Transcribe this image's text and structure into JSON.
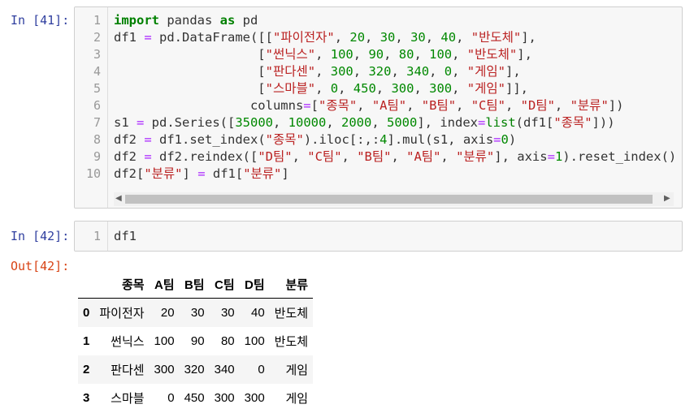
{
  "cells": [
    {
      "prompt": "In [41]:",
      "line_numbers": [
        "1",
        "2",
        "3",
        "4",
        "5",
        "6",
        "7",
        "8",
        "9",
        "10"
      ],
      "code_lines": [
        [
          {
            "t": "k",
            "v": "import"
          },
          {
            "t": "",
            "v": " pandas "
          },
          {
            "t": "k",
            "v": "as"
          },
          {
            "t": "",
            "v": " pd"
          }
        ],
        [
          {
            "t": "",
            "v": "df1 "
          },
          {
            "t": "o",
            "v": "="
          },
          {
            "t": "",
            "v": " pd.DataFrame([["
          },
          {
            "t": "s",
            "v": "\"파이전자\""
          },
          {
            "t": "",
            "v": ", "
          },
          {
            "t": "n",
            "v": "20"
          },
          {
            "t": "",
            "v": ", "
          },
          {
            "t": "n",
            "v": "30"
          },
          {
            "t": "",
            "v": ", "
          },
          {
            "t": "n",
            "v": "30"
          },
          {
            "t": "",
            "v": ", "
          },
          {
            "t": "n",
            "v": "40"
          },
          {
            "t": "",
            "v": ", "
          },
          {
            "t": "s",
            "v": "\"반도체\""
          },
          {
            "t": "",
            "v": "],"
          }
        ],
        [
          {
            "t": "",
            "v": "                   ["
          },
          {
            "t": "s",
            "v": "\"썬닉스\""
          },
          {
            "t": "",
            "v": ", "
          },
          {
            "t": "n",
            "v": "100"
          },
          {
            "t": "",
            "v": ", "
          },
          {
            "t": "n",
            "v": "90"
          },
          {
            "t": "",
            "v": ", "
          },
          {
            "t": "n",
            "v": "80"
          },
          {
            "t": "",
            "v": ", "
          },
          {
            "t": "n",
            "v": "100"
          },
          {
            "t": "",
            "v": ", "
          },
          {
            "t": "s",
            "v": "\"반도체\""
          },
          {
            "t": "",
            "v": "],"
          }
        ],
        [
          {
            "t": "",
            "v": "                   ["
          },
          {
            "t": "s",
            "v": "\"판다센\""
          },
          {
            "t": "",
            "v": ", "
          },
          {
            "t": "n",
            "v": "300"
          },
          {
            "t": "",
            "v": ", "
          },
          {
            "t": "n",
            "v": "320"
          },
          {
            "t": "",
            "v": ", "
          },
          {
            "t": "n",
            "v": "340"
          },
          {
            "t": "",
            "v": ", "
          },
          {
            "t": "n",
            "v": "0"
          },
          {
            "t": "",
            "v": ", "
          },
          {
            "t": "s",
            "v": "\"게임\""
          },
          {
            "t": "",
            "v": "],"
          }
        ],
        [
          {
            "t": "",
            "v": "                   ["
          },
          {
            "t": "s",
            "v": "\"스마블\""
          },
          {
            "t": "",
            "v": ", "
          },
          {
            "t": "n",
            "v": "0"
          },
          {
            "t": "",
            "v": ", "
          },
          {
            "t": "n",
            "v": "450"
          },
          {
            "t": "",
            "v": ", "
          },
          {
            "t": "n",
            "v": "300"
          },
          {
            "t": "",
            "v": ", "
          },
          {
            "t": "n",
            "v": "300"
          },
          {
            "t": "",
            "v": ", "
          },
          {
            "t": "s",
            "v": "\"게임\""
          },
          {
            "t": "",
            "v": "]],"
          }
        ],
        [
          {
            "t": "",
            "v": "                  columns"
          },
          {
            "t": "o",
            "v": "="
          },
          {
            "t": "",
            "v": "["
          },
          {
            "t": "s",
            "v": "\"종목\""
          },
          {
            "t": "",
            "v": ", "
          },
          {
            "t": "s",
            "v": "\"A팀\""
          },
          {
            "t": "",
            "v": ", "
          },
          {
            "t": "s",
            "v": "\"B팀\""
          },
          {
            "t": "",
            "v": ", "
          },
          {
            "t": "s",
            "v": "\"C팀\""
          },
          {
            "t": "",
            "v": ", "
          },
          {
            "t": "s",
            "v": "\"D팀\""
          },
          {
            "t": "",
            "v": ", "
          },
          {
            "t": "s",
            "v": "\"분류\""
          },
          {
            "t": "",
            "v": "])"
          }
        ],
        [
          {
            "t": "",
            "v": "s1 "
          },
          {
            "t": "o",
            "v": "="
          },
          {
            "t": "",
            "v": " pd.Series(["
          },
          {
            "t": "n",
            "v": "35000"
          },
          {
            "t": "",
            "v": ", "
          },
          {
            "t": "n",
            "v": "10000"
          },
          {
            "t": "",
            "v": ", "
          },
          {
            "t": "n",
            "v": "2000"
          },
          {
            "t": "",
            "v": ", "
          },
          {
            "t": "n",
            "v": "5000"
          },
          {
            "t": "",
            "v": "], index"
          },
          {
            "t": "o",
            "v": "="
          },
          {
            "t": "b",
            "v": "list"
          },
          {
            "t": "",
            "v": "(df1["
          },
          {
            "t": "s",
            "v": "\"종목\""
          },
          {
            "t": "",
            "v": "]))"
          }
        ],
        [
          {
            "t": "",
            "v": "df2 "
          },
          {
            "t": "o",
            "v": "="
          },
          {
            "t": "",
            "v": " df1.set_index("
          },
          {
            "t": "s",
            "v": "\"종목\""
          },
          {
            "t": "",
            "v": ").iloc[:,:"
          },
          {
            "t": "n",
            "v": "4"
          },
          {
            "t": "",
            "v": "].mul(s1, axis"
          },
          {
            "t": "o",
            "v": "="
          },
          {
            "t": "n",
            "v": "0"
          },
          {
            "t": "",
            "v": ")"
          }
        ],
        [
          {
            "t": "",
            "v": "df2 "
          },
          {
            "t": "o",
            "v": "="
          },
          {
            "t": "",
            "v": " df2.reindex(["
          },
          {
            "t": "s",
            "v": "\"D팀\""
          },
          {
            "t": "",
            "v": ", "
          },
          {
            "t": "s",
            "v": "\"C팀\""
          },
          {
            "t": "",
            "v": ", "
          },
          {
            "t": "s",
            "v": "\"B팀\""
          },
          {
            "t": "",
            "v": ", "
          },
          {
            "t": "s",
            "v": "\"A팀\""
          },
          {
            "t": "",
            "v": ", "
          },
          {
            "t": "s",
            "v": "\"분류\""
          },
          {
            "t": "",
            "v": "], axis"
          },
          {
            "t": "o",
            "v": "="
          },
          {
            "t": "n",
            "v": "1"
          },
          {
            "t": "",
            "v": ").reset_index()"
          }
        ],
        [
          {
            "t": "",
            "v": "df2["
          },
          {
            "t": "s",
            "v": "\"분류\""
          },
          {
            "t": "",
            "v": "] "
          },
          {
            "t": "o",
            "v": "="
          },
          {
            "t": "",
            "v": " df1["
          },
          {
            "t": "s",
            "v": "\"분류\""
          },
          {
            "t": "",
            "v": "]"
          }
        ]
      ],
      "scroll_left_icon": "◀",
      "scroll_right_icon": "▶"
    },
    {
      "prompt": "In [42]:",
      "line_numbers": [
        "1"
      ],
      "code_lines": [
        [
          {
            "t": "",
            "v": "df1"
          }
        ]
      ]
    }
  ],
  "output": {
    "prompt": "Out[42]:",
    "columns": [
      "",
      "종목",
      "A팀",
      "B팀",
      "C팀",
      "D팀",
      "분류"
    ],
    "rows": [
      {
        "index": "0",
        "cells": [
          "파이전자",
          "20",
          "30",
          "30",
          "40",
          "반도체"
        ]
      },
      {
        "index": "1",
        "cells": [
          "썬닉스",
          "100",
          "90",
          "80",
          "100",
          "반도체"
        ]
      },
      {
        "index": "2",
        "cells": [
          "판다센",
          "300",
          "320",
          "340",
          "0",
          "게임"
        ]
      },
      {
        "index": "3",
        "cells": [
          "스마블",
          "0",
          "450",
          "300",
          "300",
          "게임"
        ]
      }
    ]
  }
}
